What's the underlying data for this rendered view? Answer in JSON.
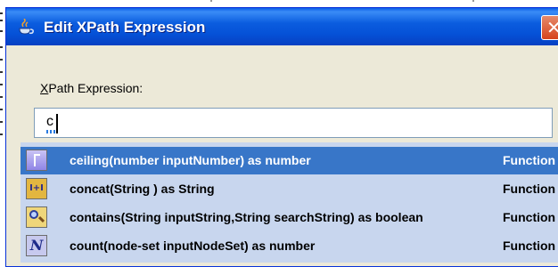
{
  "dialog": {
    "title": "Edit XPath Expression",
    "close_symbol": "✕",
    "field_label_mnemonic": "X",
    "field_label_rest": "Path Expression:",
    "expression_value": "c"
  },
  "suggestions": [
    {
      "signature": "ceiling(number inputNumber) as number",
      "type": "Function",
      "icon": "ceiling-function-icon",
      "icon_text": "",
      "selected": true
    },
    {
      "signature": "concat(String ) as String",
      "type": "Function",
      "icon": "concat-function-icon",
      "icon_text": "I+I",
      "selected": false
    },
    {
      "signature": "contains(String inputString,String searchString) as boolean",
      "type": "Function",
      "icon": "contains-magnifier-icon",
      "icon_text": "",
      "selected": false
    },
    {
      "signature": "count(node-set inputNodeSet) as number",
      "type": "Function",
      "icon": "count-function-icon",
      "icon_text": "N",
      "selected": false
    }
  ],
  "colors": {
    "titlebar": "#0551d7",
    "selection": "#3876c8",
    "list_background": "#c8d6ee",
    "close_button": "#d6431c"
  }
}
